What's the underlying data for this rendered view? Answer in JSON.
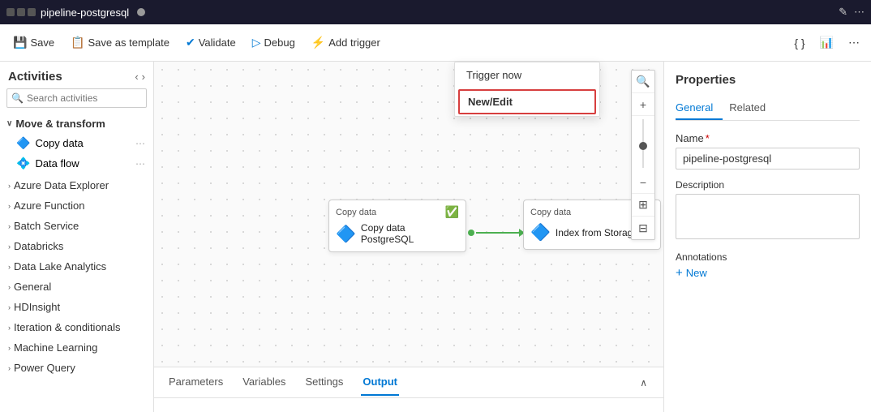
{
  "titlebar": {
    "icon": "⬛⬛⬛",
    "title": "pipeline-postgresql",
    "close_dot": "●",
    "edit_icon": "✎",
    "more_icon": "⋯"
  },
  "toolbar": {
    "save_label": "Save",
    "save_as_template_label": "Save as template",
    "validate_label": "Validate",
    "debug_label": "Debug",
    "add_trigger_label": "Add trigger",
    "code_icon": "{ }",
    "monitor_icon": "📊",
    "more_icon": "⋯"
  },
  "dropdown": {
    "trigger_now_label": "Trigger now",
    "new_edit_label": "New/Edit"
  },
  "sidebar": {
    "title": "Activities",
    "collapse_icon": "«",
    "expand_icon": "»",
    "search_placeholder": "Search activities",
    "groups": [
      {
        "label": "Move & transform",
        "expanded": true,
        "items": [
          {
            "label": "Copy data",
            "icon": "🔵"
          },
          {
            "label": "Data flow",
            "icon": "💠"
          }
        ]
      }
    ],
    "categories": [
      {
        "label": "Azure Data Explorer"
      },
      {
        "label": "Azure Function"
      },
      {
        "label": "Batch Service"
      },
      {
        "label": "Databricks"
      },
      {
        "label": "Data Lake Analytics"
      },
      {
        "label": "General"
      },
      {
        "label": "HDInsight"
      },
      {
        "label": "Iteration & conditionals"
      },
      {
        "label": "Machine Learning"
      },
      {
        "label": "Power Query"
      }
    ]
  },
  "canvas": {
    "nodes": [
      {
        "id": "node1",
        "type_label": "Copy data",
        "name": "Copy data PostgreSQL"
      },
      {
        "id": "node2",
        "type_label": "Copy data",
        "name": "Index from Storage"
      }
    ]
  },
  "bottom_panel": {
    "tabs": [
      {
        "label": "Parameters",
        "active": false
      },
      {
        "label": "Variables",
        "active": false
      },
      {
        "label": "Settings",
        "active": false
      },
      {
        "label": "Output",
        "active": true
      }
    ],
    "chevron": "∧"
  },
  "properties": {
    "title": "Properties",
    "tabs": [
      {
        "label": "General",
        "active": true
      },
      {
        "label": "Related",
        "active": false
      }
    ],
    "name_label": "Name",
    "name_required": "*",
    "name_value": "pipeline-postgresql",
    "description_label": "Description",
    "description_value": "",
    "annotations_label": "Annotations",
    "add_new_label": "New"
  }
}
